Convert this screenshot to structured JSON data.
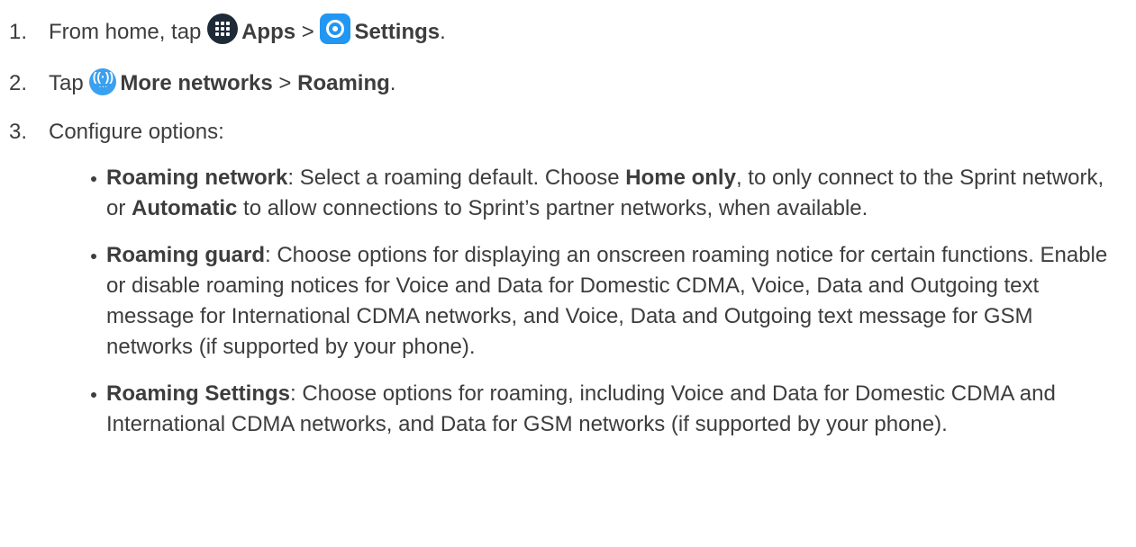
{
  "steps": [
    {
      "num": "1.",
      "pre": "From home, tap",
      "b1": "Apps",
      "sep": ">",
      "b2": "Settings",
      "post": "."
    },
    {
      "num": "2.",
      "pre": "Tap",
      "b1": "More networks",
      "sep": ">",
      "b2": "Roaming",
      "post": "."
    },
    {
      "num": "3.",
      "text": "Configure options:"
    }
  ],
  "bullets": [
    {
      "term": "Roaming network",
      "t1": ": Select a roaming default. Choose ",
      "b1": "Home only",
      "t2": ", to only connect to the Sprint network, or ",
      "b2": "Automatic",
      "t3": " to allow connections to Sprint’s partner networks, when available."
    },
    {
      "term": "Roaming guard",
      "text": ": Choose options for displaying an onscreen roaming notice for certain functions. Enable or disable roaming notices for Voice and Data for Domestic CDMA, Voice, Data and Outgoing text message for International CDMA networks, and Voice, Data and Outgoing text message for GSM networks (if supported by your phone)."
    },
    {
      "term": "Roaming Settings",
      "text": ": Choose options for roaming, including Voice and Data for Domestic CDMA and International CDMA networks, and Data for GSM networks (if supported by your phone)."
    }
  ],
  "icons": {
    "apps": "apps-grid-icon",
    "settings": "settings-gear-icon",
    "network": "more-networks-icon"
  },
  "colors": {
    "text": "#3d3d3d",
    "settings_blue": "#2196f3",
    "network_blue": "#3aa0f0",
    "apps_dark": "#1e2a38"
  }
}
